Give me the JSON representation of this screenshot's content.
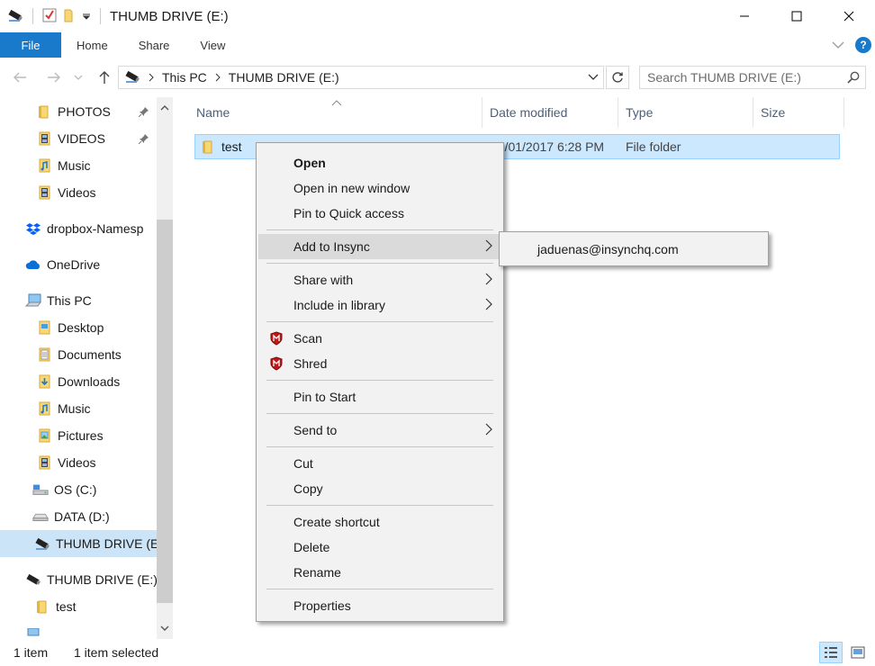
{
  "window": {
    "title": "THUMB DRIVE (E:)"
  },
  "ribbon": {
    "tabs": [
      "File",
      "Home",
      "Share",
      "View"
    ],
    "help": "?"
  },
  "address": {
    "crumbs": [
      "This PC",
      "THUMB DRIVE (E:)"
    ],
    "search_placeholder": "Search THUMB DRIVE (E:)"
  },
  "nav": {
    "items": [
      {
        "label": "PHOTOS",
        "icon": "folder-pinned-icon",
        "pinned": true
      },
      {
        "label": "VIDEOS",
        "icon": "video-folder-icon",
        "pinned": true
      },
      {
        "label": "Music",
        "icon": "music-folder-icon"
      },
      {
        "label": "Videos",
        "icon": "video-folder-icon"
      },
      {
        "label": "dropbox-Namesp",
        "icon": "dropbox-icon"
      },
      {
        "label": "OneDrive",
        "icon": "onedrive-cloud-icon"
      },
      {
        "label": "This PC",
        "icon": "computer-icon"
      },
      {
        "label": "Desktop",
        "icon": "desktop-folder-icon"
      },
      {
        "label": "Documents",
        "icon": "documents-folder-icon"
      },
      {
        "label": "Downloads",
        "icon": "downloads-folder-icon"
      },
      {
        "label": "Music",
        "icon": "music-folder-icon"
      },
      {
        "label": "Pictures",
        "icon": "pictures-folder-icon"
      },
      {
        "label": "Videos",
        "icon": "video-folder-icon"
      },
      {
        "label": "OS (C:)",
        "icon": "os-drive-icon"
      },
      {
        "label": "DATA (D:)",
        "icon": "drive-icon"
      },
      {
        "label": "THUMB DRIVE (E",
        "icon": "usb-drive-icon",
        "selected": true
      },
      {
        "label": "THUMB DRIVE (E:)",
        "icon": "usb-drive-icon"
      },
      {
        "label": "test",
        "icon": "folder-icon"
      }
    ]
  },
  "columns": {
    "name": "Name",
    "date": "Date modified",
    "type": "Type",
    "size": "Size"
  },
  "files": [
    {
      "name": "test",
      "date": "20/01/2017 6:28 PM",
      "type": "File folder",
      "size": ""
    }
  ],
  "status": {
    "count": "1 item",
    "selected": "1 item selected"
  },
  "context_menu": {
    "open": "Open",
    "open_new_window": "Open in new window",
    "pin_quick_access": "Pin to Quick access",
    "add_to_insync": "Add to Insync",
    "share_with": "Share with",
    "include_in_library": "Include in library",
    "scan": "Scan",
    "shred": "Shred",
    "pin_to_start": "Pin to Start",
    "send_to": "Send to",
    "cut": "Cut",
    "copy": "Copy",
    "create_shortcut": "Create shortcut",
    "delete": "Delete",
    "rename": "Rename",
    "properties": "Properties"
  },
  "submenu": {
    "account": "jaduenas@insynchq.com"
  },
  "colors": {
    "accent": "#1979ca",
    "selection": "#cce8ff",
    "folder": "#f8d775"
  }
}
